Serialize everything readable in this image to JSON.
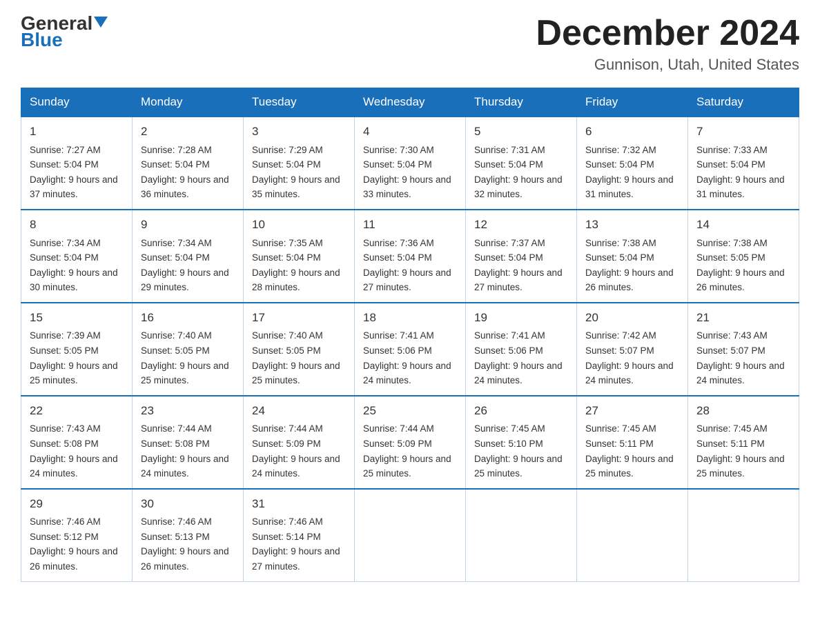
{
  "logo": {
    "general_text": "General",
    "blue_text": "Blue"
  },
  "title": {
    "month_year": "December 2024",
    "location": "Gunnison, Utah, United States"
  },
  "weekdays": [
    "Sunday",
    "Monday",
    "Tuesday",
    "Wednesday",
    "Thursday",
    "Friday",
    "Saturday"
  ],
  "weeks": [
    [
      {
        "day": "1",
        "sunrise": "7:27 AM",
        "sunset": "5:04 PM",
        "daylight": "9 hours and 37 minutes."
      },
      {
        "day": "2",
        "sunrise": "7:28 AM",
        "sunset": "5:04 PM",
        "daylight": "9 hours and 36 minutes."
      },
      {
        "day": "3",
        "sunrise": "7:29 AM",
        "sunset": "5:04 PM",
        "daylight": "9 hours and 35 minutes."
      },
      {
        "day": "4",
        "sunrise": "7:30 AM",
        "sunset": "5:04 PM",
        "daylight": "9 hours and 33 minutes."
      },
      {
        "day": "5",
        "sunrise": "7:31 AM",
        "sunset": "5:04 PM",
        "daylight": "9 hours and 32 minutes."
      },
      {
        "day": "6",
        "sunrise": "7:32 AM",
        "sunset": "5:04 PM",
        "daylight": "9 hours and 31 minutes."
      },
      {
        "day": "7",
        "sunrise": "7:33 AM",
        "sunset": "5:04 PM",
        "daylight": "9 hours and 31 minutes."
      }
    ],
    [
      {
        "day": "8",
        "sunrise": "7:34 AM",
        "sunset": "5:04 PM",
        "daylight": "9 hours and 30 minutes."
      },
      {
        "day": "9",
        "sunrise": "7:34 AM",
        "sunset": "5:04 PM",
        "daylight": "9 hours and 29 minutes."
      },
      {
        "day": "10",
        "sunrise": "7:35 AM",
        "sunset": "5:04 PM",
        "daylight": "9 hours and 28 minutes."
      },
      {
        "day": "11",
        "sunrise": "7:36 AM",
        "sunset": "5:04 PM",
        "daylight": "9 hours and 27 minutes."
      },
      {
        "day": "12",
        "sunrise": "7:37 AM",
        "sunset": "5:04 PM",
        "daylight": "9 hours and 27 minutes."
      },
      {
        "day": "13",
        "sunrise": "7:38 AM",
        "sunset": "5:04 PM",
        "daylight": "9 hours and 26 minutes."
      },
      {
        "day": "14",
        "sunrise": "7:38 AM",
        "sunset": "5:05 PM",
        "daylight": "9 hours and 26 minutes."
      }
    ],
    [
      {
        "day": "15",
        "sunrise": "7:39 AM",
        "sunset": "5:05 PM",
        "daylight": "9 hours and 25 minutes."
      },
      {
        "day": "16",
        "sunrise": "7:40 AM",
        "sunset": "5:05 PM",
        "daylight": "9 hours and 25 minutes."
      },
      {
        "day": "17",
        "sunrise": "7:40 AM",
        "sunset": "5:05 PM",
        "daylight": "9 hours and 25 minutes."
      },
      {
        "day": "18",
        "sunrise": "7:41 AM",
        "sunset": "5:06 PM",
        "daylight": "9 hours and 24 minutes."
      },
      {
        "day": "19",
        "sunrise": "7:41 AM",
        "sunset": "5:06 PM",
        "daylight": "9 hours and 24 minutes."
      },
      {
        "day": "20",
        "sunrise": "7:42 AM",
        "sunset": "5:07 PM",
        "daylight": "9 hours and 24 minutes."
      },
      {
        "day": "21",
        "sunrise": "7:43 AM",
        "sunset": "5:07 PM",
        "daylight": "9 hours and 24 minutes."
      }
    ],
    [
      {
        "day": "22",
        "sunrise": "7:43 AM",
        "sunset": "5:08 PM",
        "daylight": "9 hours and 24 minutes."
      },
      {
        "day": "23",
        "sunrise": "7:44 AM",
        "sunset": "5:08 PM",
        "daylight": "9 hours and 24 minutes."
      },
      {
        "day": "24",
        "sunrise": "7:44 AM",
        "sunset": "5:09 PM",
        "daylight": "9 hours and 24 minutes."
      },
      {
        "day": "25",
        "sunrise": "7:44 AM",
        "sunset": "5:09 PM",
        "daylight": "9 hours and 25 minutes."
      },
      {
        "day": "26",
        "sunrise": "7:45 AM",
        "sunset": "5:10 PM",
        "daylight": "9 hours and 25 minutes."
      },
      {
        "day": "27",
        "sunrise": "7:45 AM",
        "sunset": "5:11 PM",
        "daylight": "9 hours and 25 minutes."
      },
      {
        "day": "28",
        "sunrise": "7:45 AM",
        "sunset": "5:11 PM",
        "daylight": "9 hours and 25 minutes."
      }
    ],
    [
      {
        "day": "29",
        "sunrise": "7:46 AM",
        "sunset": "5:12 PM",
        "daylight": "9 hours and 26 minutes."
      },
      {
        "day": "30",
        "sunrise": "7:46 AM",
        "sunset": "5:13 PM",
        "daylight": "9 hours and 26 minutes."
      },
      {
        "day": "31",
        "sunrise": "7:46 AM",
        "sunset": "5:14 PM",
        "daylight": "9 hours and 27 minutes."
      },
      null,
      null,
      null,
      null
    ]
  ]
}
